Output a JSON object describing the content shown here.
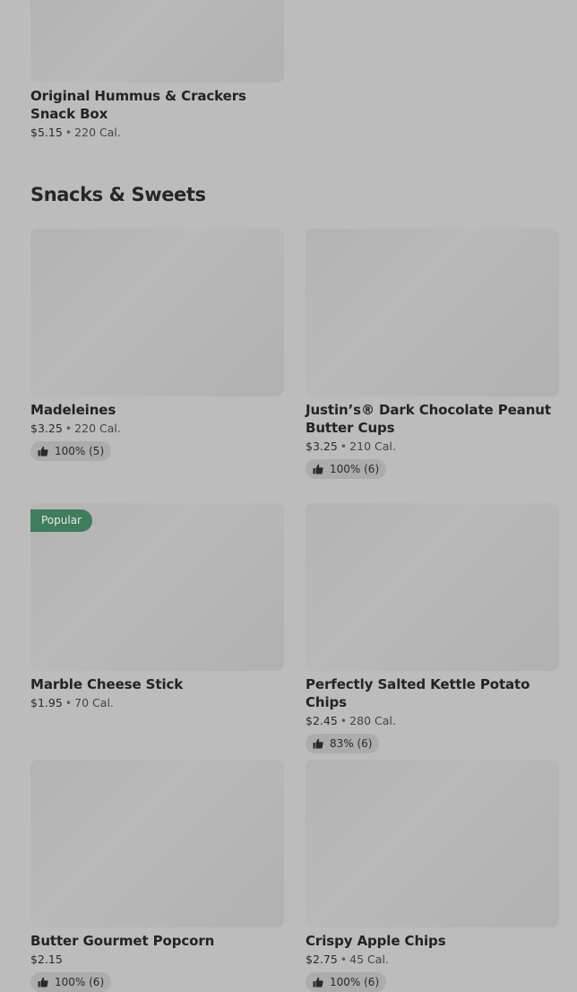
{
  "top_item": {
    "name": "Original Hummus & Crackers Snack Box",
    "price": "$5.15",
    "separator": "•",
    "calories": "220 Cal."
  },
  "section": {
    "title": "Snacks & Sweets"
  },
  "items": [
    {
      "name": "Madeleines",
      "price": "$3.25",
      "separator": "•",
      "calories": "220 Cal.",
      "rating": "100% (5)"
    },
    {
      "name": "Justin’s® Dark Chocolate Peanut Butter Cups",
      "price": "$3.25",
      "separator": "•",
      "calories": "210 Cal.",
      "rating": "100% (6)"
    },
    {
      "name": "Marble Cheese Stick",
      "price": "$1.95",
      "separator": "•",
      "calories": "70 Cal.",
      "badge": "Popular"
    },
    {
      "name": "Perfectly Salted Kettle Potato Chips",
      "price": "$2.45",
      "separator": "•",
      "calories": "280 Cal.",
      "rating": "83% (6)"
    },
    {
      "name": "Butter Gourmet Popcorn",
      "price": "$2.15",
      "rating": "100% (6)"
    },
    {
      "name": "Crispy Apple Chips",
      "price": "$2.75",
      "separator": "•",
      "calories": "45 Cal.",
      "rating": "100% (6)"
    }
  ],
  "colors": {
    "background": "#bcbcbc",
    "badge": "#3f7d5c",
    "rating_pill": "#acacac"
  },
  "icons": {
    "rating": "thumbs-up-icon"
  }
}
